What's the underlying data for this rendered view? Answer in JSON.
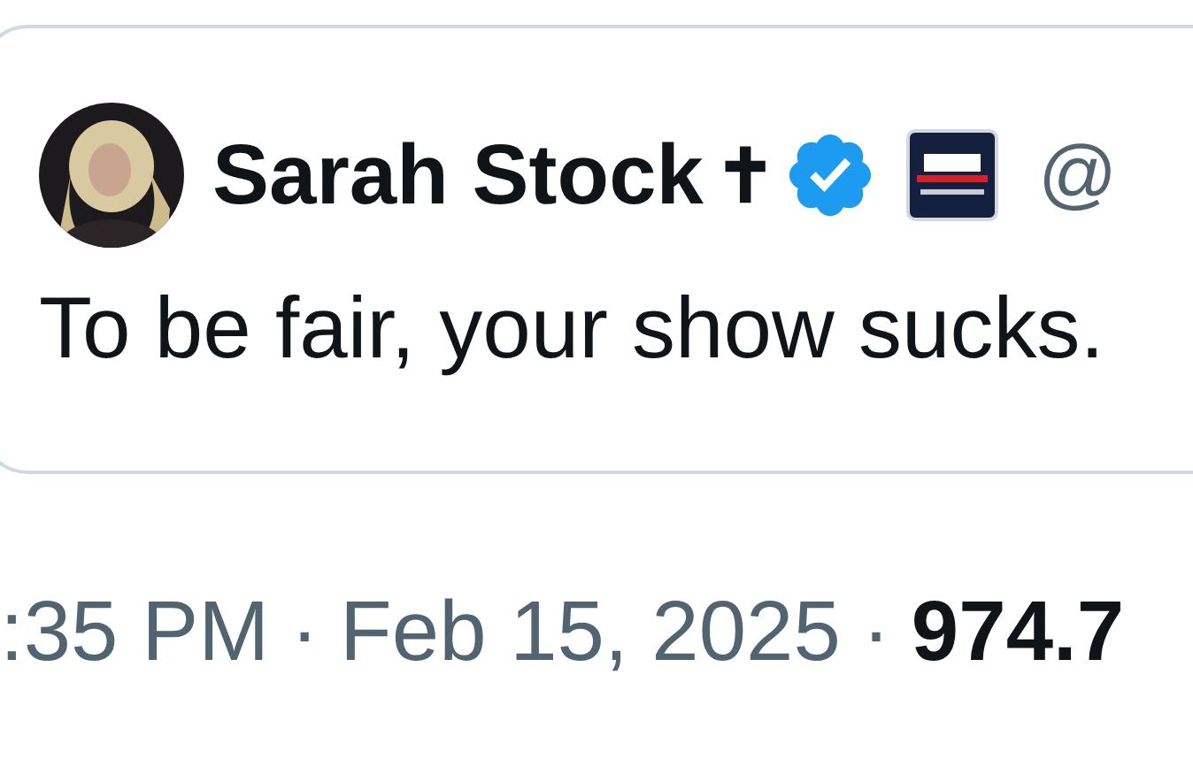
{
  "quoted_post": {
    "author": {
      "name": "Sarah Stock",
      "name_emoji": "✝",
      "verified": true,
      "affiliate_badge": true,
      "handle": "@"
    },
    "text": "To be fair, your show sucks."
  },
  "meta": {
    "time": ":35 PM",
    "separator_1": "·",
    "date": "Feb 15, 2025",
    "separator_2": "·",
    "views": "974.7"
  }
}
